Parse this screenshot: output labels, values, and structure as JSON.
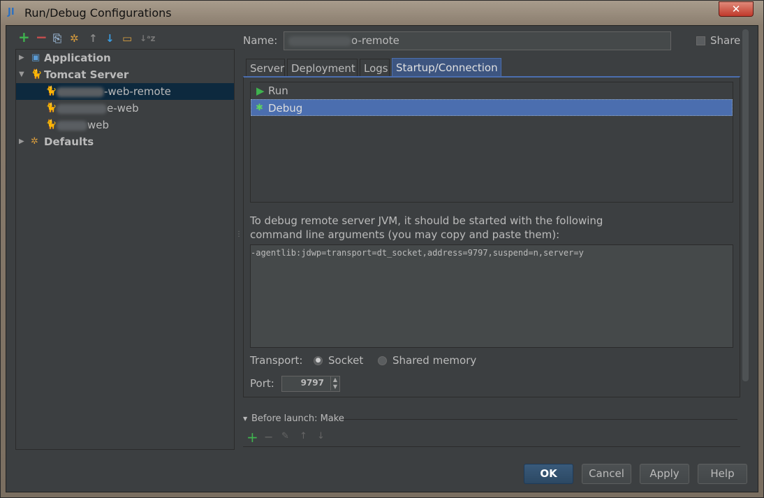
{
  "window": {
    "title": "Run/Debug Configurations",
    "close": "✕"
  },
  "toolbar": {
    "add": "+",
    "remove": "−",
    "copy": "⎘",
    "edit_defaults": "✲",
    "up": "↑",
    "down": "↓",
    "folder": "▭",
    "sort": "↓ᵃz"
  },
  "tree": {
    "items": [
      {
        "label": "Application",
        "expanded": false
      },
      {
        "label": "Tomcat Server",
        "expanded": true
      },
      {
        "label": "-web-remote",
        "selected": true
      },
      {
        "label": "e-web"
      },
      {
        "label": "web"
      },
      {
        "label": "Defaults",
        "expanded": false
      }
    ]
  },
  "form": {
    "name_label": "Name:",
    "name_value": "o-remote",
    "share_label": "Share",
    "share_checked": false
  },
  "tabs": [
    "Server",
    "Deployment",
    "Logs",
    "Startup/Connection"
  ],
  "active_tab": "Startup/Connection",
  "modes": [
    {
      "label": "Run"
    },
    {
      "label": "Debug",
      "selected": true
    }
  ],
  "debug_info": {
    "line1": "To debug remote server JVM, it should be started with the following",
    "line2": "command line arguments (you may copy and paste them):",
    "args": "-agentlib:jdwp=transport=dt_socket,address=9797,suspend=n,server=y"
  },
  "transport": {
    "label": "Transport:",
    "options": [
      "Socket",
      "Shared memory"
    ],
    "selected": "Socket"
  },
  "port": {
    "label": "Port:",
    "value": "9797"
  },
  "before_launch": {
    "label": "Before launch: Make"
  },
  "buttons": {
    "ok": "OK",
    "cancel": "Cancel",
    "apply": "Apply",
    "help": "Help"
  },
  "colors": {
    "selection": "#4b6eaf",
    "tree_selection": "#0d293e",
    "bg": "#3c3f41"
  }
}
